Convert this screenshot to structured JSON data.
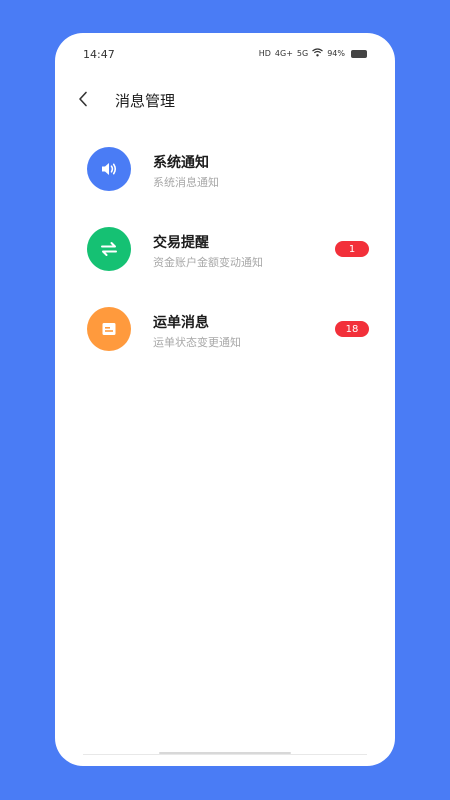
{
  "status_bar": {
    "time": "14:47",
    "hd_label": "HD",
    "net1_label": "4G+",
    "net2_label": "5G",
    "battery_text": "94%"
  },
  "header": {
    "back_icon": "chevron-left-icon",
    "title": "消息管理"
  },
  "messages": [
    {
      "title": "系统通知",
      "subtitle": "系统消息通知",
      "icon": "speaker-icon",
      "color": "#4a7cf5",
      "badge": ""
    },
    {
      "title": "交易提醒",
      "subtitle": "资金账户金额变动通知",
      "icon": "swap-arrows-icon",
      "color": "#15c173",
      "badge": "1"
    },
    {
      "title": "运单消息",
      "subtitle": "运单状态变更通知",
      "icon": "message-lines-icon",
      "color": "#ff9a3d",
      "badge": "18"
    }
  ]
}
